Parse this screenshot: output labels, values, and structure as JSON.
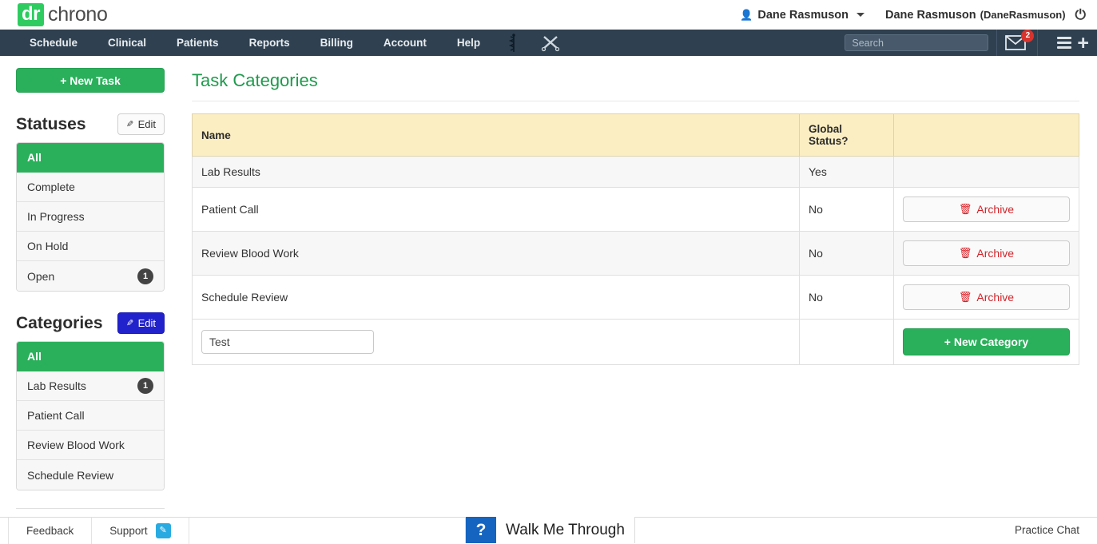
{
  "brand": {
    "logo_mark": "dr",
    "logo_text": "chrono",
    "green": "#2ab05b",
    "navy": "#2f4050",
    "blue": "#2222cc",
    "header_yellow": "#fbeec3",
    "danger_red": "#d0242a"
  },
  "topbar": {
    "user_icon": "user-icon",
    "user_menu_label": "Dane Rasmuson",
    "user_full_name": "Dane Rasmuson",
    "user_handle": "(DaneRasmuson)",
    "power_icon": "⏻"
  },
  "nav": {
    "items": [
      {
        "label": "Schedule",
        "name": "nav-schedule"
      },
      {
        "label": "Clinical",
        "name": "nav-clinical"
      },
      {
        "label": "Patients",
        "name": "nav-patients"
      },
      {
        "label": "Reports",
        "name": "nav-reports"
      },
      {
        "label": "Billing",
        "name": "nav-billing"
      },
      {
        "label": "Account",
        "name": "nav-account"
      },
      {
        "label": "Help",
        "name": "nav-help"
      }
    ],
    "icons": [
      {
        "name": "caduceus-icon"
      },
      {
        "name": "crossed-scalpels-icon"
      }
    ],
    "search_placeholder": "Search",
    "search_value": "",
    "mail_badge": "2",
    "mail_icon": "envelope-icon",
    "hamburger_icon": "hamburger-icon",
    "plus_icon": "plus-icon"
  },
  "sidebar": {
    "new_task_label": "New Task",
    "statuses": {
      "title": "Statuses",
      "edit_label": "Edit",
      "items": [
        {
          "label": "All",
          "count": "",
          "active": true
        },
        {
          "label": "Complete",
          "count": "",
          "active": false
        },
        {
          "label": "In Progress",
          "count": "",
          "active": false
        },
        {
          "label": "On Hold",
          "count": "",
          "active": false
        },
        {
          "label": "Open",
          "count": "1",
          "active": false
        }
      ]
    },
    "categories": {
      "title": "Categories",
      "edit_label": "Edit",
      "items": [
        {
          "label": "All",
          "count": "",
          "active": true
        },
        {
          "label": "Lab Results",
          "count": "1",
          "active": false
        },
        {
          "label": "Patient Call",
          "count": "",
          "active": false
        },
        {
          "label": "Review Blood Work",
          "count": "",
          "active": false
        },
        {
          "label": "Schedule Review",
          "count": "",
          "active": false
        }
      ]
    }
  },
  "main": {
    "page_title": "Task Categories",
    "table": {
      "columns": [
        "Name",
        "Global Status?",
        ""
      ],
      "rows": [
        {
          "name": "Lab Results",
          "global_status": "Yes",
          "action": ""
        },
        {
          "name": "Patient Call",
          "global_status": "No",
          "action": "Archive"
        },
        {
          "name": "Review Blood Work",
          "global_status": "No",
          "action": "Archive"
        },
        {
          "name": "Schedule Review",
          "global_status": "No",
          "action": "Archive"
        }
      ],
      "new_row": {
        "input_value": "Test",
        "input_placeholder": "",
        "button_label": "New Category"
      }
    }
  },
  "footer": {
    "feedback_label": "Feedback",
    "support_label": "Support",
    "pencil_icon": "pencil-icon",
    "walkme_icon": "?",
    "walkme_label": "Walk Me Through",
    "practice_chat_label": "Practice Chat"
  }
}
